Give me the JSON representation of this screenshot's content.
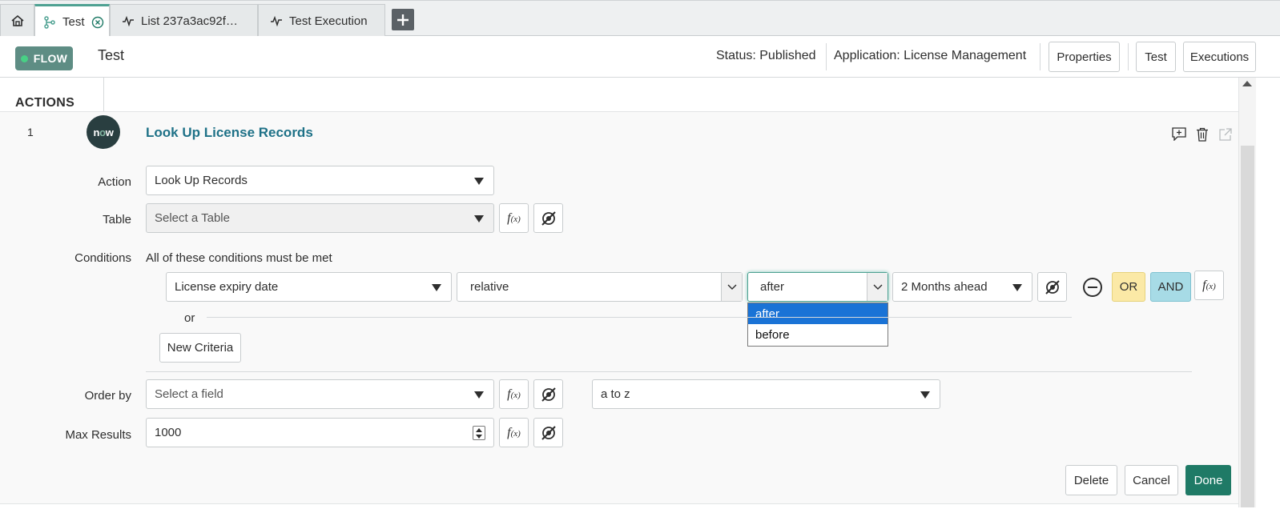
{
  "tabs": [
    {
      "label": "Test",
      "icon": "flow-icon",
      "active": true
    },
    {
      "label": "List 237a3ac92f…",
      "icon": "execution-icon"
    },
    {
      "label": "Test Execution",
      "icon": "execution-icon"
    }
  ],
  "header": {
    "badge": "FLOW",
    "flow_name": "Test",
    "status": "Status: Published",
    "application": "Application: License Management",
    "properties_btn": "Properties",
    "test_btn": "Test",
    "executions_btn": "Executions"
  },
  "actions": {
    "section_label": "ACTIONS",
    "step": {
      "number": "1",
      "logo_text": "now",
      "title": "Look Up License Records"
    }
  },
  "form": {
    "action_label": "Action",
    "action_value": "Look Up Records",
    "table_label": "Table",
    "table_placeholder": "Select a Table",
    "conditions_label": "Conditions",
    "conditions_header": "All of these conditions must be met",
    "condition": {
      "field": "License expiry date",
      "operator": "relative",
      "direction": "after",
      "value": "2 Months ahead"
    },
    "direction_options": [
      "after",
      "before"
    ],
    "or_separator": "or",
    "or_btn": "OR",
    "and_btn": "AND",
    "new_criteria_btn": "New Criteria",
    "order_by_label": "Order by",
    "order_by_placeholder": "Select a field",
    "order_dir": "a to z",
    "max_results_label": "Max Results",
    "max_results_value": "1000"
  },
  "footer": {
    "delete_btn": "Delete",
    "cancel_btn": "Cancel",
    "done_btn": "Done"
  },
  "colors": {
    "accent": "#1f7a66",
    "link": "#1e7187",
    "or_bg": "#fbe9a6",
    "and_bg": "#a7dbe6",
    "selection": "#1a73d6"
  }
}
